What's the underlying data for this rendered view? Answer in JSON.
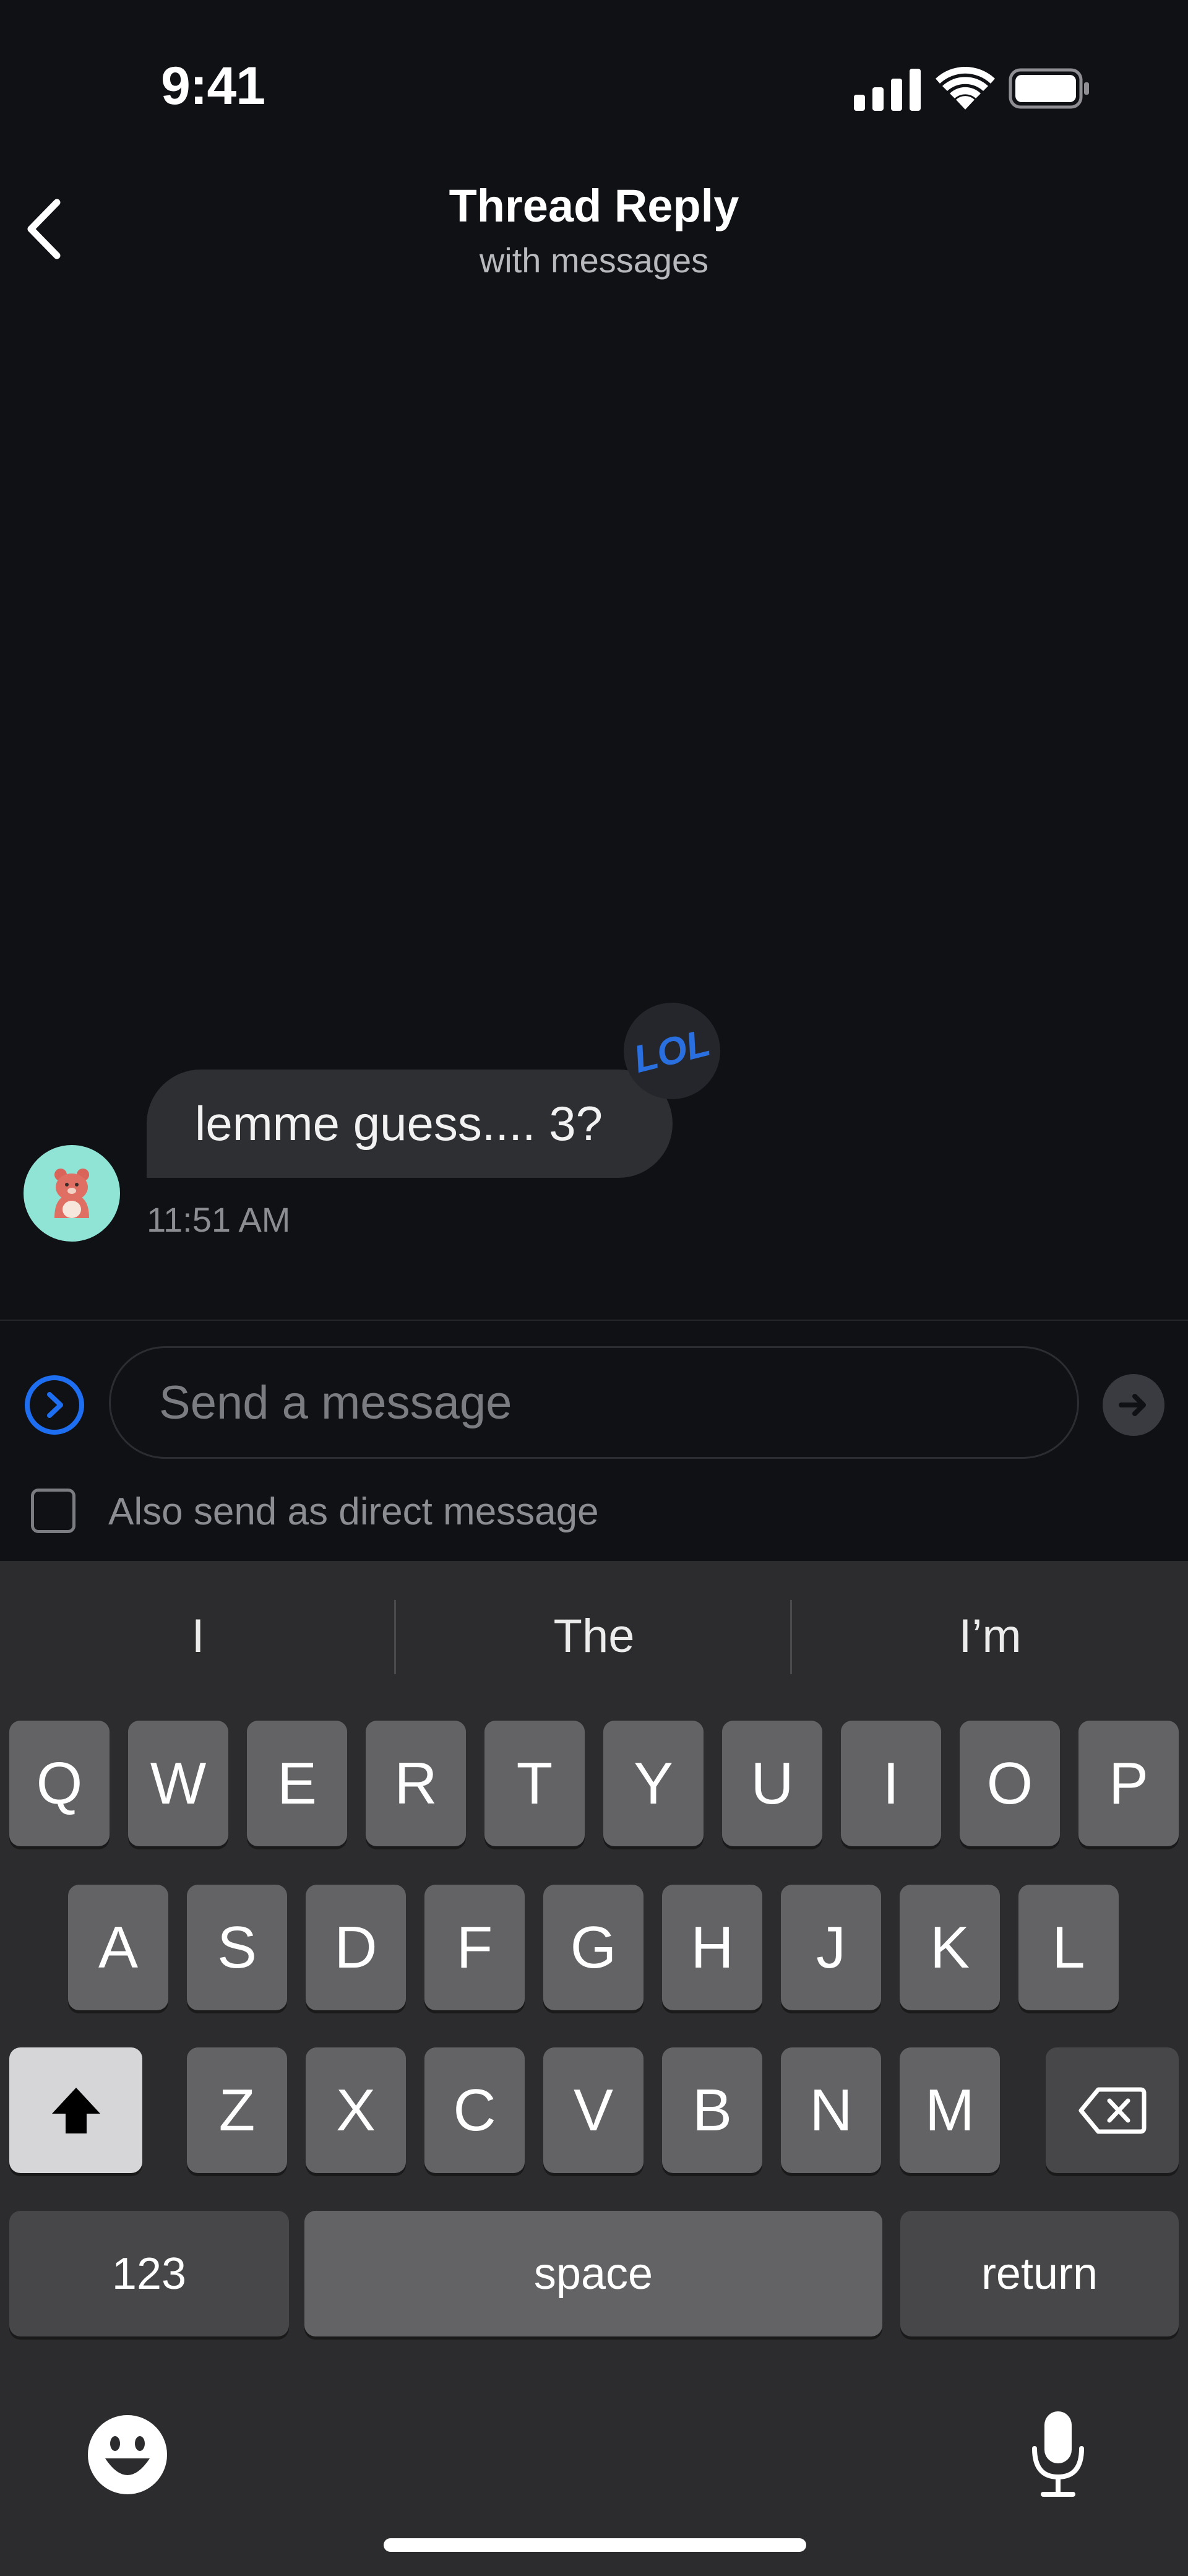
{
  "status_bar": {
    "time": "9:41",
    "icons": [
      "cellular-signal-icon",
      "wifi-icon",
      "battery-icon"
    ]
  },
  "header": {
    "title": "Thread Reply",
    "subtitle": "with messages",
    "back_icon": "chevron-left-icon"
  },
  "message": {
    "text": "lemme guess.... 3?",
    "time": "11:51 AM",
    "reaction": "LOL",
    "avatar_icon": "bear-avatar"
  },
  "composer": {
    "placeholder": "Send a message",
    "value": "",
    "also_send_label": "Also send as direct message",
    "also_send_checked": false
  },
  "keyboard": {
    "suggestions": [
      "I",
      "The",
      "I’m"
    ],
    "row1": [
      "Q",
      "W",
      "E",
      "R",
      "T",
      "Y",
      "U",
      "I",
      "O",
      "P"
    ],
    "row2": [
      "A",
      "S",
      "D",
      "F",
      "G",
      "H",
      "J",
      "K",
      "L"
    ],
    "row3": [
      "Z",
      "X",
      "C",
      "V",
      "B",
      "N",
      "M"
    ],
    "numbers_label": "123",
    "space_label": "space",
    "return_label": "return",
    "shift_icon": "shift-icon",
    "delete_icon": "delete-icon",
    "emoji_icon": "emoji-icon",
    "mic_icon": "microphone-icon"
  },
  "colors": {
    "background": "#101115",
    "bubble": "#2e2f33",
    "accent": "#1d6ef0",
    "keyboard": "#2c2c2e",
    "key": "#636366"
  }
}
